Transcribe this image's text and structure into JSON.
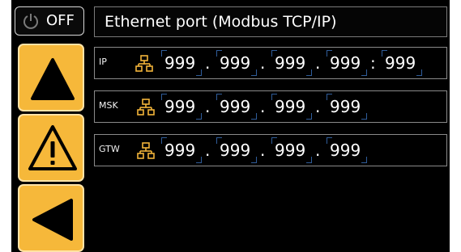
{
  "header": {
    "power_label": "OFF",
    "power_icon": "power-icon",
    "title": "Ethernet port (Modbus TCP/IP)"
  },
  "nav": {
    "buttons": [
      {
        "icon": "triangle-up-icon"
      },
      {
        "icon": "warning-icon"
      },
      {
        "icon": "triangle-left-icon"
      }
    ],
    "accent_color": "#f6b83a"
  },
  "rows": [
    {
      "label": "IP",
      "octets": [
        "999",
        "999",
        "999",
        "999"
      ],
      "separators": [
        ".",
        ".",
        "."
      ],
      "port_separator": ":",
      "port": "999"
    },
    {
      "label": "MSK",
      "octets": [
        "999",
        "999",
        "999",
        "999"
      ],
      "separators": [
        ".",
        ".",
        "."
      ]
    },
    {
      "label": "GTW",
      "octets": [
        "999",
        "999",
        "999",
        "999"
      ],
      "separators": [
        ".",
        ".",
        "."
      ]
    }
  ],
  "colors": {
    "network_icon": "#f2b43a",
    "field_bracket": "#2f5c99"
  }
}
